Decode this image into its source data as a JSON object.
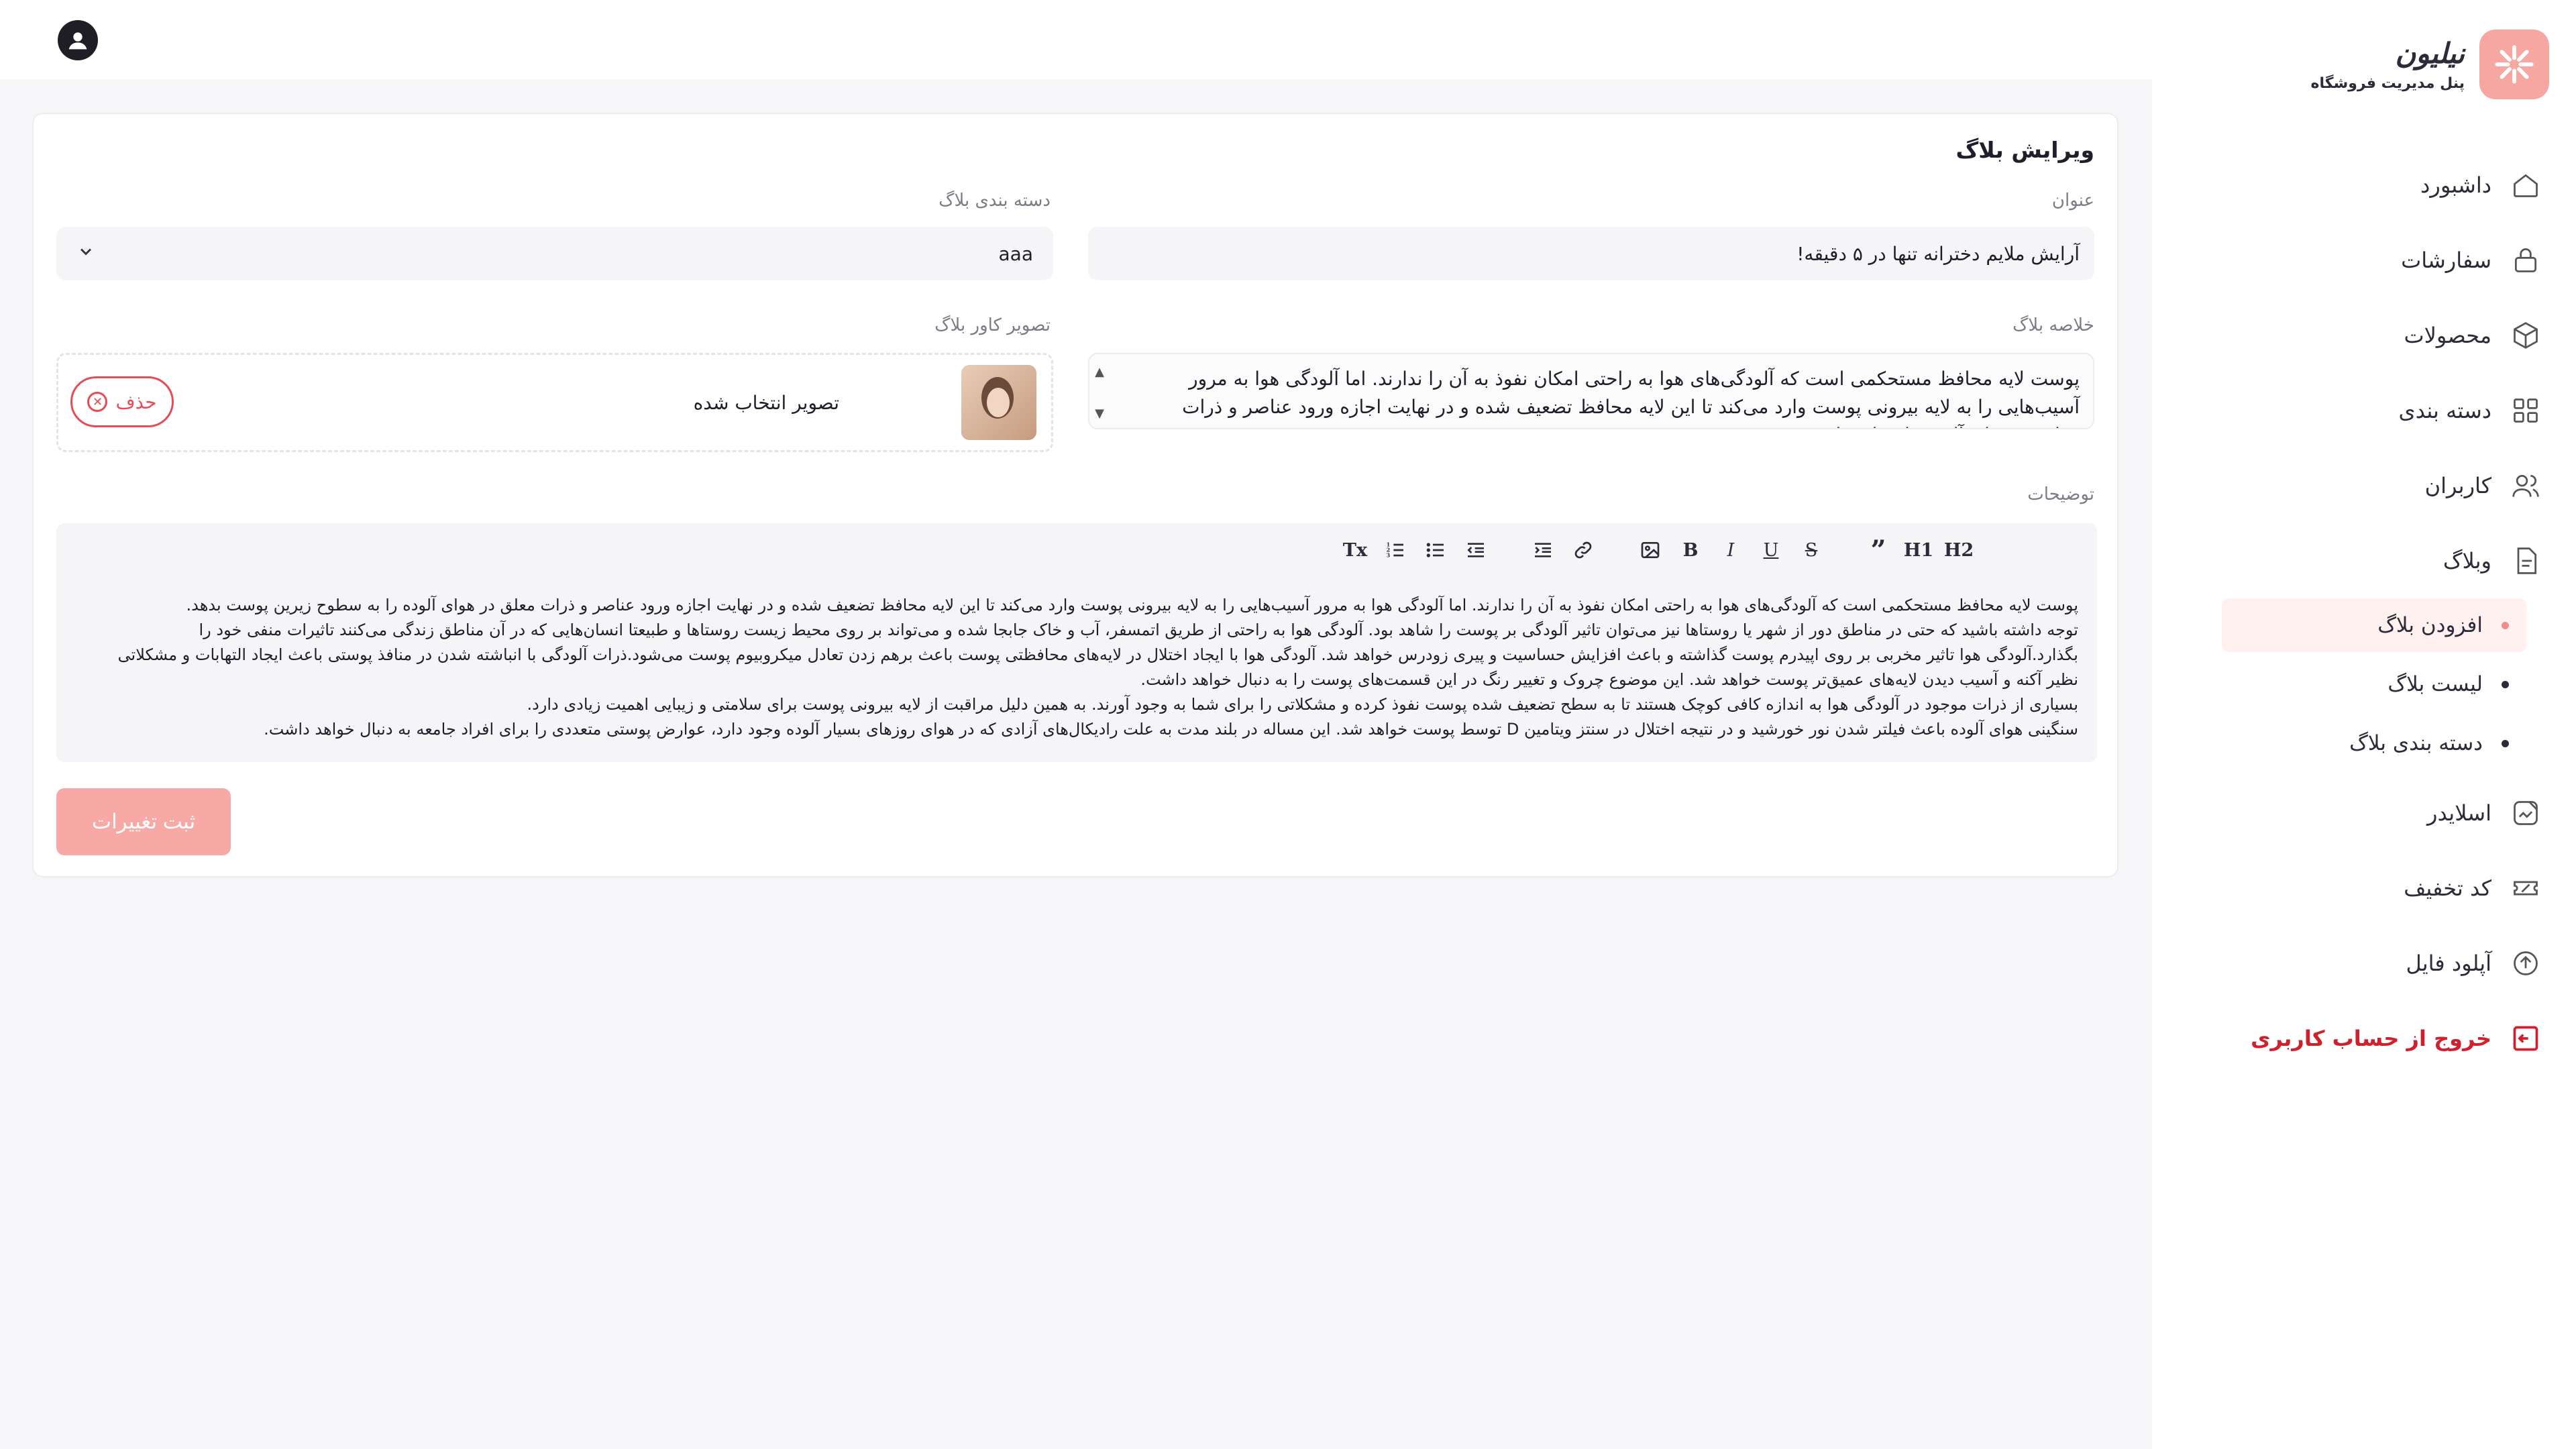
{
  "brand": {
    "name": "نیلیون",
    "subtitle": "پنل مدیریت فروشگاه"
  },
  "nav": {
    "dashboard": "داشبورد",
    "orders": "سفارشات",
    "products": "محصولات",
    "categories": "دسته بندی",
    "users": "کاربران",
    "blog": "وبلاگ",
    "blog_sub": [
      "افزودن بلاگ",
      "لیست بلاگ",
      "دسته بندی بلاگ"
    ],
    "slider": "اسلایدر",
    "discount": "کد تخفیف",
    "upload": "آپلود فایل",
    "logout": "خروج از حساب کاربری"
  },
  "icons": [
    "user-icon",
    "home-icon",
    "lock-bag-icon",
    "box-icon",
    "grid-icon",
    "users-icon",
    "document-icon",
    "image-edit-icon",
    "ticket-icon",
    "upload-icon",
    "logout-icon"
  ],
  "colors": {
    "accent": "#f7a7a2",
    "danger": "#e64c55",
    "logout": "#d11f2c"
  },
  "form": {
    "title_heading": "ویرایش بلاگ",
    "title_label": "عنوان",
    "title_value": "آرایش ملایم دخترانه تنها در ۵ دقیقه!",
    "category_label": "دسته بندی بلاگ",
    "category_value": "aaa",
    "summary_label": "خلاصه بلاگ",
    "summary_text": "پوست لایه محافظ مستحکمی است که آلودگی‌های هوا به راحتی امکان نفوذ به آن را ندارند. اما آلودگی هوا به مرور آسیب‌هایی را به لایه بیرونی پوست وارد می‌کند تا این لایه محافظ تضعیف شده و در نهایت اجازه ورود عناصر و ذرات معلق در هوای آلوده را به لایه‌های زیرین پوست بدهد.",
    "cover_label": "تصویر کاور بلاگ",
    "cover_status": "تصویر انتخاب شده",
    "delete_label": "حذف",
    "description_label": "توضیحات",
    "toolbar": {
      "h1": "H1",
      "h2": "H2",
      "quote": "”",
      "bold": "B",
      "italic": "I",
      "underline": "U",
      "strike": "S",
      "clear": "Tx"
    },
    "description_lines": [
      "پوست لایه محافظ مستحکمی است که آلودگی‌های هوا به راحتی امکان نفوذ به آن را ندارند. اما آلودگی هوا به مرور آسیب‌هایی را به لایه بیرونی پوست وارد می‌کند تا این لایه محافظ تضعیف شده و در نهایت اجازه ورود عناصر و ذرات معلق در هوای آلوده را به سطوح زیرین پوست بدهد.",
      "توجه داشته باشید که حتی در مناطق دور از شهر یا روستاها نیز می‌توان تاثیر آلودگی بر پوست را شاهد بود. آلودگی هوا به راحتی از طریق اتمسفر، آب و خاک جابجا شده و می‌تواند بر روی محیط زیست روستاها و طبیعتا انسان‌هایی که در آن مناطق زندگی می‌کنند تاثیرات منفی خود را بگذارد.آلودگی هوا تاثیر مخربی بر روی اپیدرم پوست گذاشته و باعث افزایش حساسیت و پیری زودرس خواهد شد. آلودگی هوا با ایجاد اختلال در لایه‌های محافظتی پوست باعث برهم زدن تعادل میکروبیوم پوست می‌شود.ذرات آلودگی با انباشته شدن در منافذ پوستی باعث ایجاد التهابات و مشکلاتی نظیر آکنه و آسیب دیدن لایه‌های عمیق‌تر پوست خواهد شد. این موضوع چروک و تغییر رنگ در این قسمت‌های پوست را به دنبال خواهد داشت.",
      "بسیاری از ذرات موجود در آلودگی هوا به اندازه کافی کوچک هستند تا به سطح تضعیف شده پوست نفوذ کرده و مشکلاتی را برای شما به وجود آورند. به همین دلیل مراقبت از لایه بیرونی پوست برای سلامتی و زیبایی اهمیت زیادی دارد.",
      "سنگینی هوای آلوده باعث فیلتر شدن نور خورشید و در نتیجه اختلال در سنتز ویتامین D توسط پوست خواهد شد. این مساله در بلند مدت به علت رادیکال‌های آزادی که در هوای روزهای بسیار آلوده وجود دارد، عوارض پوستی متعددی را برای افراد جامعه به دنبال خواهد داشت."
    ],
    "save_label": "ثبت تغییرات"
  }
}
